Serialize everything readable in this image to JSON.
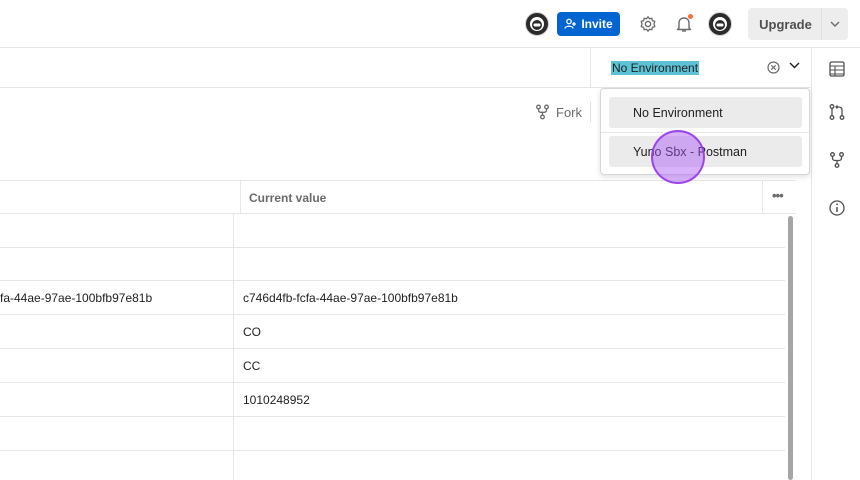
{
  "header": {
    "invite_label": "Invite",
    "upgrade_label": "Upgrade",
    "accent_color": "#0265d2",
    "notification_dot_color": "#ff6c37"
  },
  "environment": {
    "selected": "No Environment",
    "options": [
      "No Environment",
      "Yuno Sbx - Postman"
    ]
  },
  "toolbar": {
    "fork_label": "Fork"
  },
  "table": {
    "header_current_value": "Current value",
    "more_label": "•••",
    "rows": [
      {
        "variable_fragment": "",
        "current_value": ""
      },
      {
        "variable_fragment": "",
        "current_value": ""
      },
      {
        "variable_fragment": "fa-44ae-97ae-100bfb97e81b",
        "current_value": "c746d4fb-fcfa-44ae-97ae-100bfb97e81b"
      },
      {
        "variable_fragment": "",
        "current_value": "CO"
      },
      {
        "variable_fragment": "",
        "current_value": "CC"
      },
      {
        "variable_fragment": "",
        "current_value": "1010248952"
      },
      {
        "variable_fragment": "",
        "current_value": ""
      },
      {
        "variable_fragment": "",
        "current_value": ""
      }
    ]
  }
}
